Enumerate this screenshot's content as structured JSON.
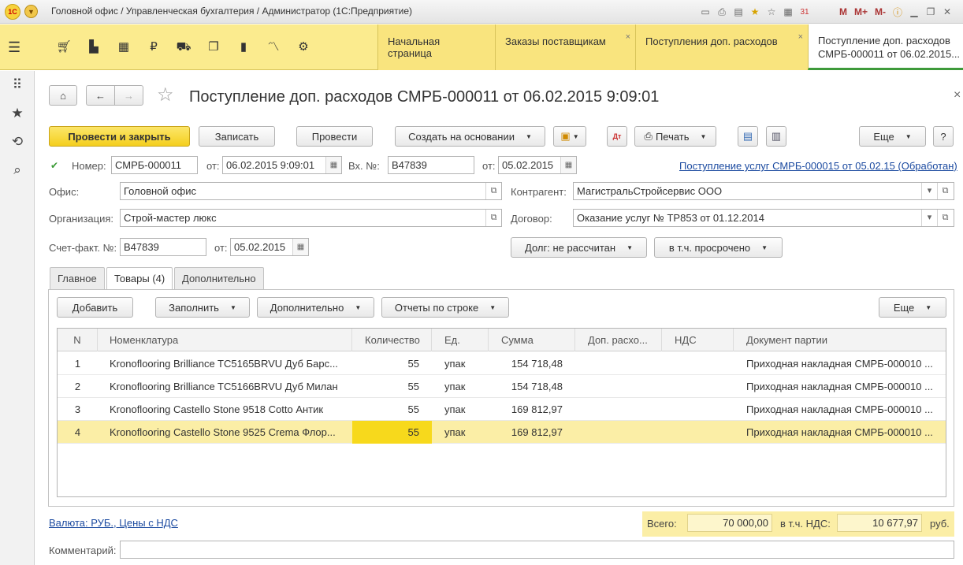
{
  "window": {
    "title": "Головной офис / Управленческая бухгалтерия / Администратор  (1С:Предприятие)",
    "logo_text": "1С",
    "toolbar_icons": [
      "save-icon",
      "print-icon",
      "preview-icon",
      "favorite-icon",
      "favorites-list-icon",
      "calculator-icon",
      "calendar-icon"
    ],
    "memory": [
      "M",
      "M+",
      "M-"
    ],
    "calendar_day": "31"
  },
  "sections": {
    "icons": [
      "cart-icon",
      "bag-icon",
      "grid-icon",
      "ruble-icon",
      "truck-icon",
      "documents-icon",
      "bar-chart-icon",
      "trend-icon",
      "gear-icon"
    ]
  },
  "open_tabs": [
    {
      "label": "Начальная страница",
      "closable": false
    },
    {
      "label": "Заказы поставщикам",
      "closable": true
    },
    {
      "label": "Поступления доп. расходов",
      "closable": true
    },
    {
      "label_line1": "Поступление доп. расходов",
      "label_line2": "СМРБ-000011 от 06.02.2015...",
      "active": true
    }
  ],
  "doc": {
    "title": "Поступление доп. расходов СМРБ-000011 от 06.02.2015 9:09:01",
    "close_glyph": "×"
  },
  "toolbar": {
    "post_close": "Провести и закрыть",
    "save": "Записать",
    "post": "Провести",
    "create_based": "Создать на основании",
    "print": "Печать",
    "more": "Еще",
    "help": "?"
  },
  "header": {
    "number_label": "Номер:",
    "number": "СМРБ-000011",
    "from_label": "от:",
    "date": "06.02.2015  9:09:01",
    "in_number_label": "Вх. №:",
    "in_number": "B47839",
    "in_from_label": "от:",
    "in_date": "05.02.2015",
    "base_link": "Поступление услуг СМРБ-000015 от 05.02.15 (Обработан)",
    "office_label": "Офис:",
    "office": "Головной офис",
    "counterparty_label": "Контрагент:",
    "counterparty": "МагистральСтройсервис ООО",
    "org_label": "Организация:",
    "org": "Строй-мастер люкс",
    "contract_label": "Договор:",
    "contract": "Оказание услуг № ТР853 от 01.12.2014",
    "invoice_label": "Счет-факт. №:",
    "invoice": "B47839",
    "invoice_from_label": "от:",
    "invoice_date": "05.02.2015",
    "debt_btn": "Долг: не рассчитан",
    "overdue_btn": "в т.ч. просрочено"
  },
  "form_tabs": [
    "Главное",
    "Товары (4)",
    "Дополнительно"
  ],
  "goods_toolbar": {
    "add": "Добавить",
    "fill": "Заполнить",
    "extra": "Дополнительно",
    "reports": "Отчеты по строке",
    "more": "Еще"
  },
  "table": {
    "columns": [
      "N",
      "Номенклатура",
      "Количество",
      "Ед.",
      "Сумма",
      "Доп. расхо...",
      "НДС",
      "Документ партии"
    ],
    "rows": [
      {
        "n": "1",
        "item": "Kronoflooring Brilliance TC5165BRVU Дуб Барс...",
        "qty": "55",
        "unit": "упак",
        "sum": "154 718,48",
        "extra": "",
        "vat": "",
        "batch": "Приходная накладная СМРБ-000010 ..."
      },
      {
        "n": "2",
        "item": "Kronoflooring Brilliance TC5166BRVU Дуб Милан",
        "qty": "55",
        "unit": "упак",
        "sum": "154 718,48",
        "extra": "",
        "vat": "",
        "batch": "Приходная накладная СМРБ-000010 ..."
      },
      {
        "n": "3",
        "item": "Kronoflooring Castello Stone 9518 Cotto Антик",
        "qty": "55",
        "unit": "упак",
        "sum": "169 812,97",
        "extra": "",
        "vat": "",
        "batch": "Приходная накладная СМРБ-000010 ..."
      },
      {
        "n": "4",
        "item": "Kronoflooring Castello Stone 9525 Crema Флор...",
        "qty": "55",
        "unit": "упак",
        "sum": "169 812,97",
        "extra": "",
        "vat": "",
        "batch": "Приходная накладная СМРБ-000010 ..."
      }
    ]
  },
  "footer": {
    "currency_link": "Валюта: РУБ., Цены с НДС",
    "total_label": "Всего:",
    "total": "70 000,00",
    "vat_label": "в т.ч. НДС:",
    "vat": "10 677,97",
    "currency": "руб.",
    "comment_label": "Комментарий:",
    "comment": ""
  }
}
